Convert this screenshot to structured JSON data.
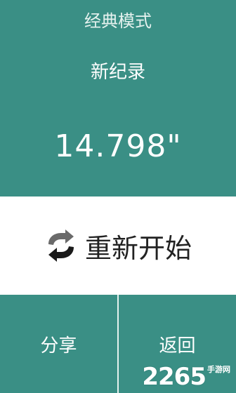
{
  "header": {
    "mode_title": "经典模式",
    "record_label": "新纪录",
    "time": "14.798\""
  },
  "restart": {
    "icon": "refresh-arrows-icon",
    "label": "重新开始"
  },
  "footer": {
    "share_label": "分享",
    "back_label": "返回"
  },
  "watermark": {
    "number": "2265",
    "text": "手游网"
  },
  "colors": {
    "teal": "#3a8f85",
    "white": "#ffffff",
    "dark_text": "#222222"
  }
}
